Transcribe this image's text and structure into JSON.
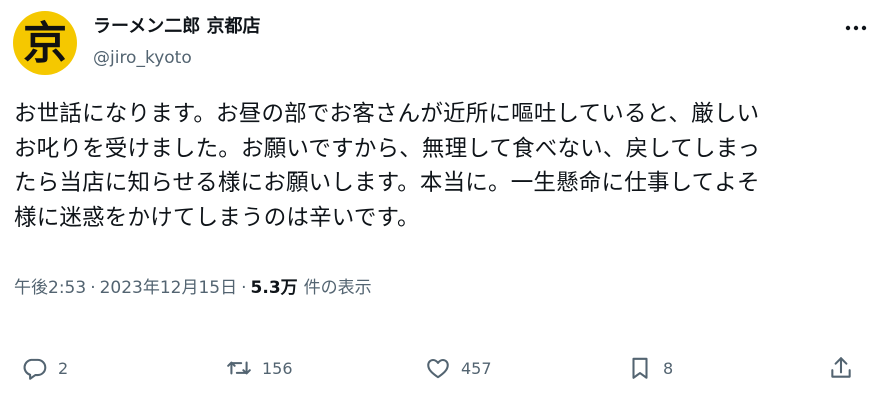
{
  "user": {
    "display_name": "ラーメン二郎 京都店",
    "handle": "@jiro_kyoto",
    "avatar_glyph": "京",
    "avatar_color": "#f5c800"
  },
  "tweet": {
    "lines": [
      "お世話になります。お昼の部でお客さんが近所に嘔吐していると、厳しい",
      "お叱りを受けました。お願いですから、無理して食べない、戻してしまっ",
      "たら当店に知らせる様にお願いします。本当に。一生懸命に仕事してよそ",
      "様に迷惑をかけてしまうのは辛いです。"
    ]
  },
  "meta": {
    "time": "午後2:53",
    "separator": "·",
    "date": "2023年12月15日",
    "views_count": "5.3万",
    "views_label": "件の表示"
  },
  "actions": {
    "reply": {
      "icon": "reply-icon",
      "count": "2"
    },
    "retweet": {
      "icon": "retweet-icon",
      "count": "156"
    },
    "like": {
      "icon": "heart-icon",
      "count": "457"
    },
    "bookmark": {
      "icon": "bookmark-icon",
      "count": "8"
    },
    "share": {
      "icon": "share-icon"
    }
  },
  "colors": {
    "text": "#0f1419",
    "secondary": "#536471"
  }
}
